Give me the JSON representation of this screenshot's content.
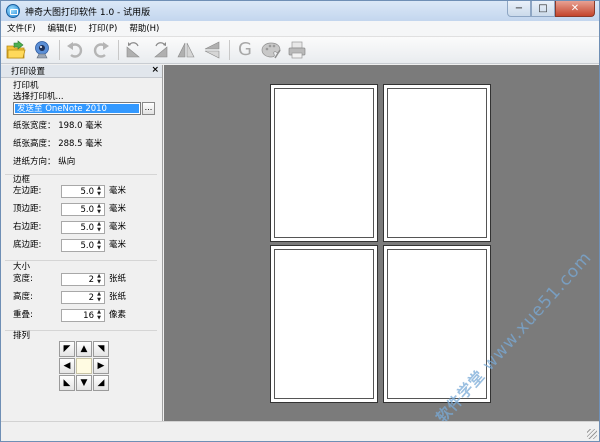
{
  "window": {
    "title": "神奇大图打印软件 1.0 - 试用版",
    "controls": {
      "minimize": "−",
      "maximize": "□",
      "close": "✕"
    }
  },
  "menu": [
    "文件(F)",
    "编辑(E)",
    "打印(P)",
    "帮助(H)"
  ],
  "toolbar": {
    "icons": [
      "open-folder-icon",
      "webcam-icon",
      "undo-icon",
      "redo-icon",
      "rotate-left-icon",
      "rotate-right-icon",
      "flip-horizontal-icon",
      "flip-vertical-icon",
      "g-icon",
      "palette-icon",
      "printer-icon"
    ],
    "g_label": "G"
  },
  "panel": {
    "title": "打印设置",
    "close": "×",
    "printer": {
      "section": "打印机",
      "select_label": "选择打印机...",
      "value": "发送至 OneNote 2010",
      "browse": "..."
    },
    "paper_width": "纸张宽度： 198.0 毫米",
    "paper_height": "纸张高度： 288.5 毫米",
    "feed_direction": "进纸方向： 纵向",
    "margins": {
      "section": "边框",
      "rows": [
        {
          "label": "左边距:",
          "value": "5.0",
          "unit": "毫米"
        },
        {
          "label": "顶边距:",
          "value": "5.0",
          "unit": "毫米"
        },
        {
          "label": "右边距:",
          "value": "5.0",
          "unit": "毫米"
        },
        {
          "label": "底边距:",
          "value": "5.0",
          "unit": "毫米"
        }
      ]
    },
    "size": {
      "section": "大小",
      "rows": [
        {
          "label": "宽度:",
          "value": "2",
          "unit": "张纸"
        },
        {
          "label": "高度:",
          "value": "2",
          "unit": "张纸"
        },
        {
          "label": "重叠:",
          "value": "16",
          "unit": "像素"
        }
      ]
    },
    "arrangement": {
      "section": "排列",
      "arrows": [
        "◤",
        "▲",
        "◥",
        "◀",
        "",
        "▶",
        "◣",
        "▼",
        "◢"
      ]
    },
    "spin_arrows": {
      "up": "▲",
      "down": "▼"
    }
  },
  "preview": {
    "pages": 4
  },
  "watermark": {
    "cn": "软件学堂",
    "url": "www.xue51.com"
  },
  "colors": {
    "preview_bg": "#7b7b7b",
    "selection": "#3399ff",
    "close_button": "#c4452c"
  }
}
